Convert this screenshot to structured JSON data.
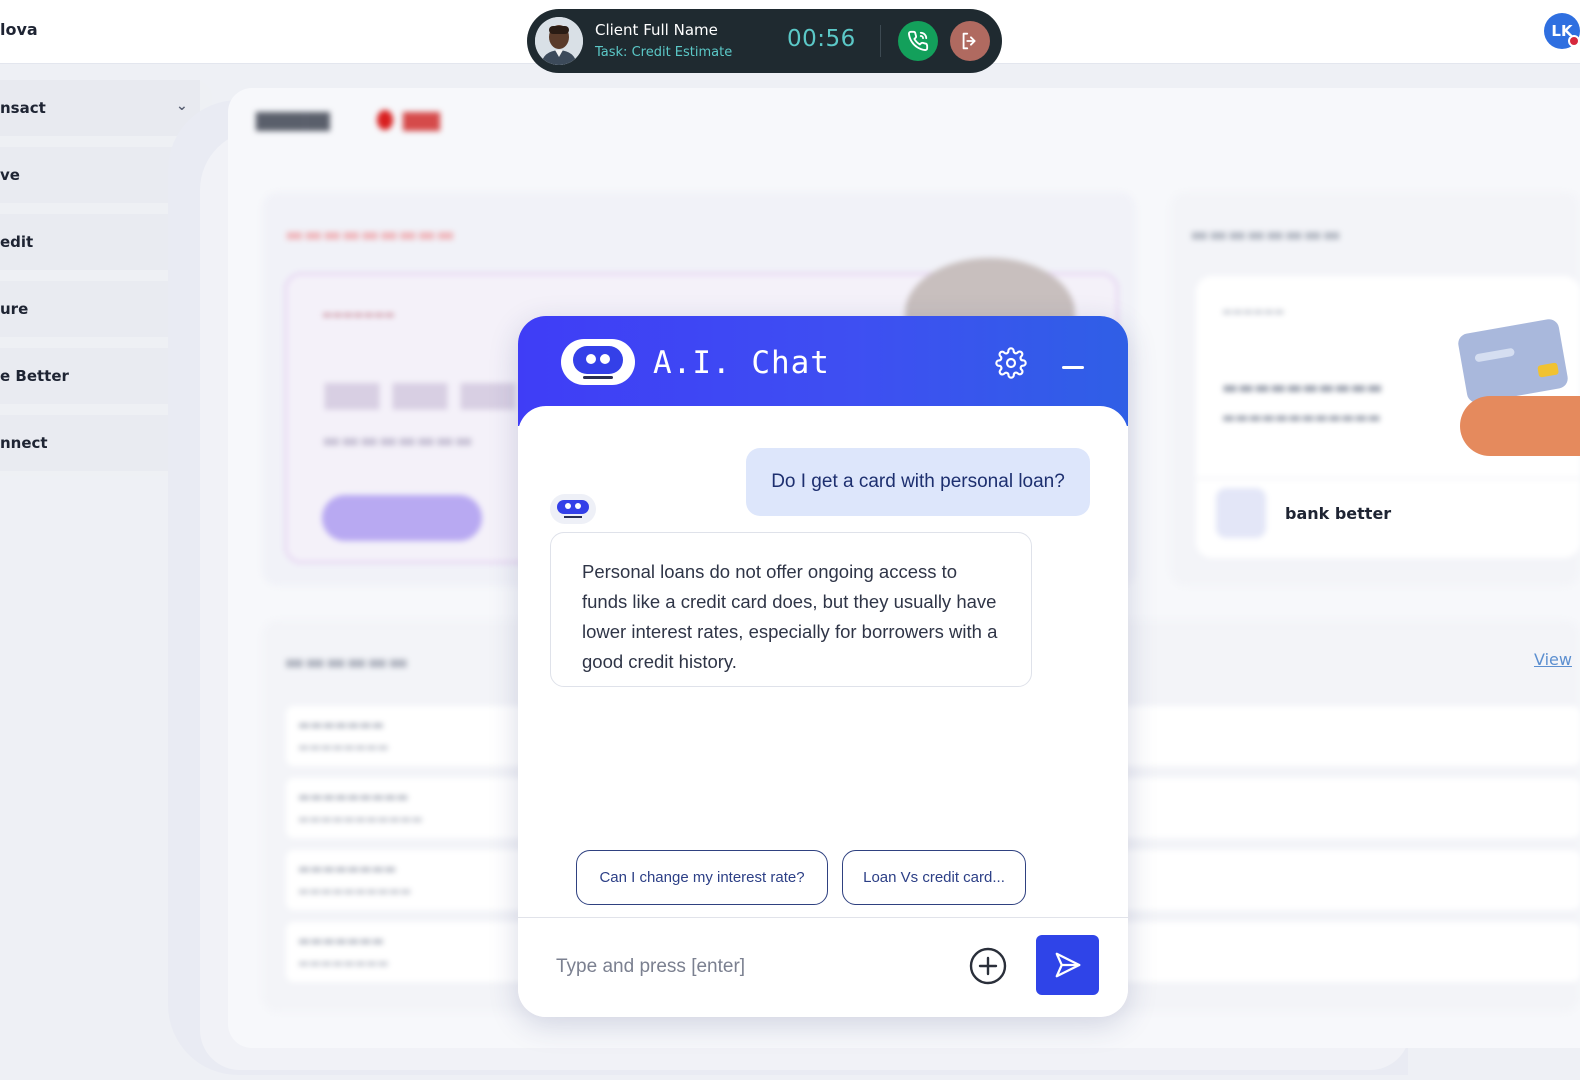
{
  "app": {
    "brand": "lova",
    "user_initials": "LK"
  },
  "call": {
    "client_name": "Client Full Name",
    "task": "Task: Credit Estimate",
    "timer": "00:56",
    "icons": {
      "phone": "phone-icon",
      "exit": "exit-icon"
    },
    "colors": {
      "phone": "#13a05b",
      "exit": "#b06a60",
      "accent": "#5bc8c7"
    }
  },
  "sidebar": {
    "items": [
      {
        "label": "nsact"
      },
      {
        "label": "ve"
      },
      {
        "label": "edit"
      },
      {
        "label": "ure"
      },
      {
        "label": "e Better"
      },
      {
        "label": "nnect"
      }
    ]
  },
  "background": {
    "nba_bank_text": "bank better",
    "history_view_link": "View"
  },
  "chat": {
    "title": "A.I. Chat",
    "messages": [
      {
        "from": "user",
        "text": "Do I get a card with personal loan?"
      },
      {
        "from": "bot",
        "text": "Personal loans do not offer ongoing access to funds like a credit card does, but they usually have lower interest rates, especially for borrowers with a good credit history."
      }
    ],
    "suggestions": [
      {
        "label": "Can I change my interest rate?"
      },
      {
        "label": "Loan Vs credit card..."
      }
    ],
    "input": {
      "placeholder": "Type and press [enter]",
      "value": ""
    },
    "colors": {
      "header": "#3f3df6",
      "send": "#2f44e8",
      "user_bubble": "#dde6fb"
    }
  }
}
